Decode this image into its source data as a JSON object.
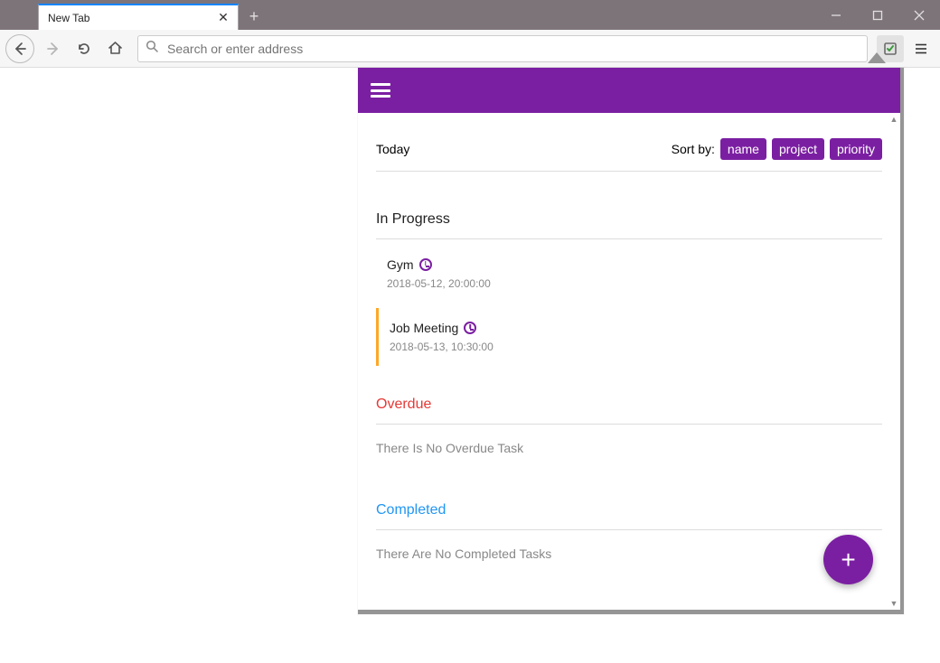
{
  "browser": {
    "tab_title": "New Tab",
    "url_placeholder": "Search or enter address"
  },
  "popup": {
    "today_label": "Today",
    "sort_by_label": "Sort by:",
    "sort_options": {
      "name": "name",
      "project": "project",
      "priority": "priority"
    },
    "sections": {
      "in_progress": {
        "title": "In Progress",
        "tasks": [
          {
            "name": "Gym",
            "time": "2018-05-12, 20:00:00",
            "highlighted": false
          },
          {
            "name": "Job Meeting",
            "time": "2018-05-13, 10:30:00",
            "highlighted": true
          }
        ]
      },
      "overdue": {
        "title": "Overdue",
        "empty_message": "There Is No Overdue Task"
      },
      "completed": {
        "title": "Completed",
        "empty_message": "There Are No Completed Tasks"
      }
    },
    "fab_label": "+"
  },
  "colors": {
    "accent": "#7b1fa2",
    "titlebar": "#7d7479",
    "tab_accent": "#0a84ff",
    "overdue": "#e53935",
    "completed": "#2196f3",
    "highlight": "#ffa726"
  }
}
